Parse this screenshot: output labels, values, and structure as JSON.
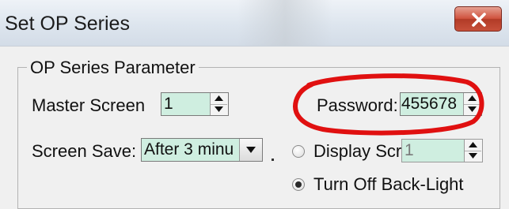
{
  "window": {
    "title": "Set OP Series",
    "close_label": "X"
  },
  "group": {
    "label": "OP Series Parameter"
  },
  "fields": {
    "master_screen": {
      "label": "Master Screen",
      "value": "1"
    },
    "password": {
      "label": "Password:",
      "value": "455678"
    },
    "screen_save": {
      "label": "Screen Save:",
      "value": "After 3 minu"
    },
    "display_screen": {
      "label": "Display Scre",
      "value": "1"
    }
  },
  "radios": {
    "display_screen": {
      "label": "Display Scre",
      "checked": false
    },
    "turn_off_backlight": {
      "label": "Turn Off Back-Light",
      "checked": true
    }
  },
  "colors": {
    "field_bg": "#cfeee0",
    "annotation": "#e01010",
    "close_button": "#c7503a"
  },
  "icons": [
    "close-icon",
    "spin-up-icon",
    "spin-down-icon",
    "dropdown-arrow-icon"
  ]
}
